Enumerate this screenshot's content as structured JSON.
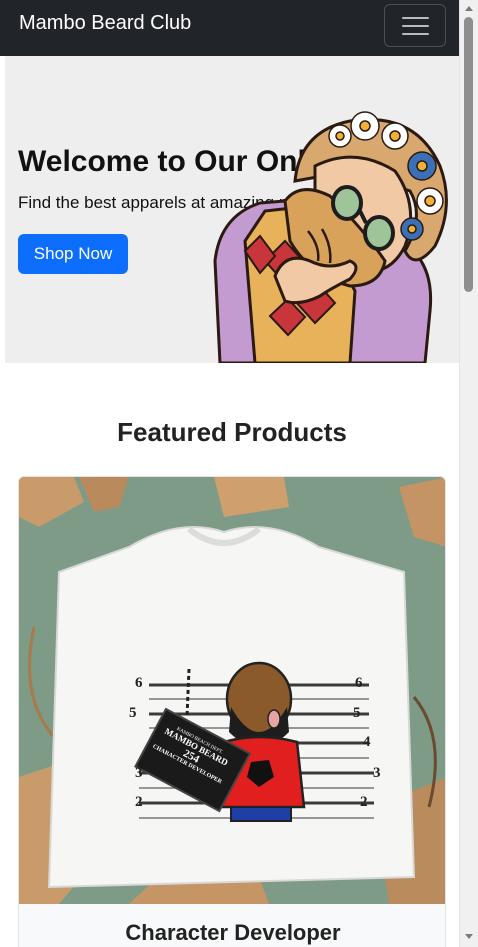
{
  "navbar": {
    "brand": "Mambo Beard Club",
    "toggler_icon": "hamburger-menu-icon"
  },
  "hero": {
    "title": "Welcome to Our Online Store",
    "subtitle": "Find the best apparels at amazing prices!",
    "button_label": "Shop Now",
    "image": "hipster-bearded-man-with-flower-crown-illustration"
  },
  "featured": {
    "heading": "Featured Products",
    "products": [
      {
        "name": "Character Developer",
        "image": "white-t-shirt-mugshot-print",
        "print": {
          "badge_line1": "KAMBO BEACH DEPT.",
          "badge_line2": "MAMBO BEARD",
          "badge_number": "254",
          "badge_line3": "CHARACTER DEVELOPER",
          "height_marks": [
            "6",
            "5",
            "4",
            "3",
            "2"
          ]
        }
      }
    ]
  },
  "colors": {
    "navbar_bg": "#212529",
    "hero_bg": "#eeeeee",
    "primary_button": "#0d6efd",
    "shirt_background": "#7d9b87"
  }
}
